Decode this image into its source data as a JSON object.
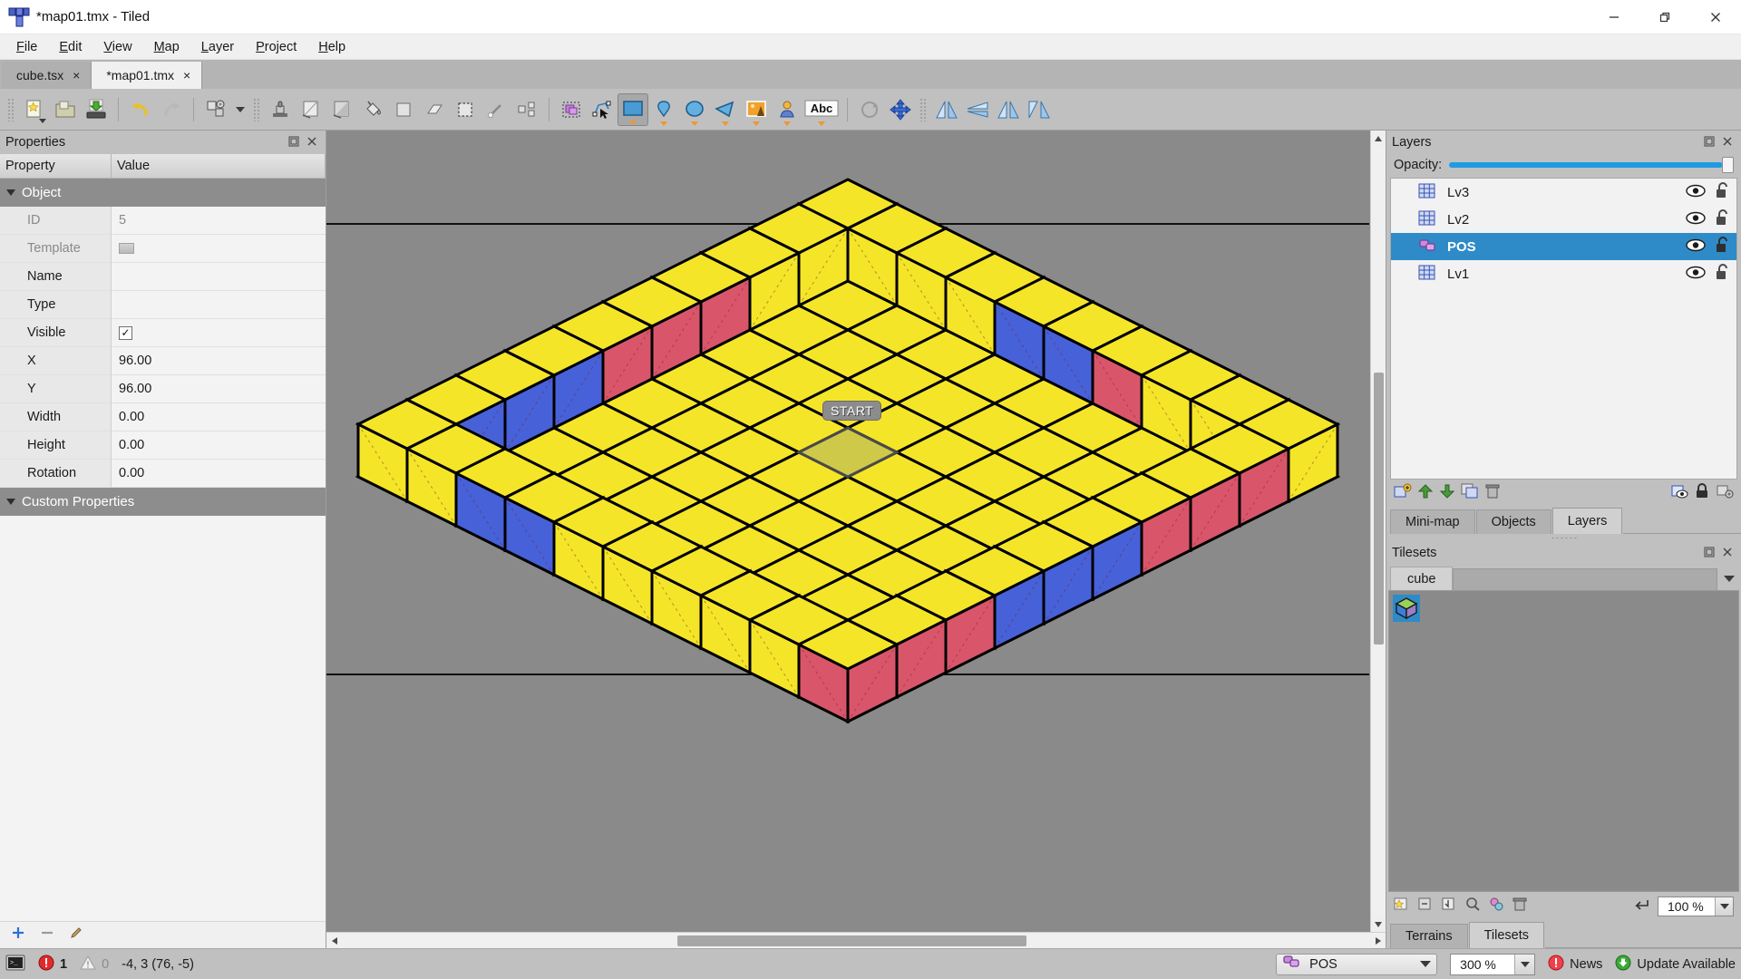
{
  "window": {
    "title": "*map01.tmx - Tiled",
    "app_icon": "tiled-logo-icon",
    "controls": {
      "minimize": "minimize-icon",
      "restore": "restore-icon",
      "close": "close-icon"
    }
  },
  "menu": {
    "items": [
      "File",
      "Edit",
      "View",
      "Map",
      "Layer",
      "Project",
      "Help"
    ]
  },
  "document_tabs": [
    {
      "label": "cube.tsx",
      "active": false,
      "close": "×"
    },
    {
      "label": "*map01.tmx",
      "active": true,
      "close": "×"
    }
  ],
  "toolbar": {
    "groups": [
      {
        "buttons": [
          {
            "name": "new-map-button",
            "icon": "new-file-icon",
            "dropdown": true
          },
          {
            "name": "open-file-button",
            "icon": "open-folder-icon"
          },
          {
            "name": "save-file-button",
            "icon": "save-disk-icon"
          }
        ]
      },
      {
        "buttons": [
          {
            "name": "undo-button",
            "icon": "undo-arrow-icon"
          },
          {
            "name": "redo-button",
            "icon": "redo-arrow-icon"
          }
        ]
      },
      {
        "buttons": [
          {
            "name": "map-properties-button",
            "icon": "map-properties-icon",
            "dropdown_separate": true
          }
        ]
      },
      {
        "buttons": [
          {
            "name": "stamp-brush-tool",
            "icon": "stamp-icon"
          },
          {
            "name": "terrain-brush-tool",
            "icon": "terrain-icon"
          },
          {
            "name": "shape-fill-tool",
            "icon": "shape-fill-icon"
          },
          {
            "name": "bucket-fill-tool",
            "icon": "bucket-fill-icon"
          },
          {
            "name": "eraser-tool",
            "icon": "eraser-square-icon"
          },
          {
            "name": "rectangle-erase-tool",
            "icon": "eraser-icon"
          },
          {
            "name": "rectangular-select-tool",
            "icon": "marquee-select-icon"
          },
          {
            "name": "magic-wand-tool",
            "icon": "magic-wand-icon"
          },
          {
            "name": "select-same-tile-tool",
            "icon": "select-same-tile-icon"
          }
        ]
      },
      {
        "buttons": [
          {
            "name": "select-objects-tool",
            "icon": "select-objects-icon"
          },
          {
            "name": "edit-polygons-tool",
            "icon": "edit-polygons-icon"
          },
          {
            "name": "insert-rectangle-tool",
            "icon": "insert-rectangle-icon",
            "active": true,
            "caret": true
          },
          {
            "name": "insert-point-tool",
            "icon": "insert-point-icon",
            "caret": true
          },
          {
            "name": "insert-ellipse-tool",
            "icon": "insert-ellipse-icon",
            "caret": true
          },
          {
            "name": "insert-polygon-tool",
            "icon": "insert-polygon-icon",
            "caret": true
          },
          {
            "name": "insert-tile-tool",
            "icon": "insert-tile-icon",
            "caret": true
          },
          {
            "name": "insert-template-tool",
            "icon": "insert-template-icon",
            "caret": true
          },
          {
            "name": "insert-text-tool",
            "icon": "insert-text-icon",
            "label": "Abc",
            "caret": true
          }
        ]
      },
      {
        "buttons": [
          {
            "name": "rotate-tool",
            "icon": "rotate-icon"
          },
          {
            "name": "move-tool",
            "icon": "move-arrows-icon"
          }
        ]
      },
      {
        "buttons": [
          {
            "name": "flip-horizontally-button",
            "icon": "flip-horizontal-icon"
          },
          {
            "name": "flip-vertically-button",
            "icon": "flip-vertical-icon"
          },
          {
            "name": "rotate-left-button",
            "icon": "rotate-left-icon"
          },
          {
            "name": "rotate-right-button",
            "icon": "rotate-right-icon"
          }
        ]
      }
    ]
  },
  "properties_panel": {
    "title": "Properties",
    "columns": [
      "Property",
      "Value"
    ],
    "group": {
      "label": "Object",
      "expanded": true
    },
    "rows": [
      {
        "key": "ID",
        "value": "5",
        "dim": true,
        "type": "text"
      },
      {
        "key": "Template",
        "value": "",
        "dim": true,
        "type": "template"
      },
      {
        "key": "Name",
        "value": "",
        "type": "text"
      },
      {
        "key": "Type",
        "value": "",
        "type": "text"
      },
      {
        "key": "Visible",
        "value": "✓",
        "type": "checkbox",
        "checked": true
      },
      {
        "key": "X",
        "value": "96.00",
        "type": "text"
      },
      {
        "key": "Y",
        "value": "96.00",
        "type": "text"
      },
      {
        "key": "Width",
        "value": "0.00",
        "type": "text"
      },
      {
        "key": "Height",
        "value": "0.00",
        "type": "text"
      },
      {
        "key": "Rotation",
        "value": "0.00",
        "type": "text"
      }
    ],
    "custom_group": {
      "label": "Custom Properties",
      "expanded": true
    },
    "footer_buttons": [
      {
        "name": "add-property-button",
        "icon": "plus-icon"
      },
      {
        "name": "remove-property-button",
        "icon": "minus-icon"
      },
      {
        "name": "edit-property-button",
        "icon": "pencil-icon"
      }
    ]
  },
  "map": {
    "start_label": "START",
    "colors": {
      "yellow": "#f5e528",
      "red": "#d9566a",
      "blue": "#4761d8",
      "outline": "#000000",
      "background": "#8a8a8a",
      "selection": "#cfc94a"
    },
    "grid": {
      "cols": 10,
      "rows": 10
    },
    "selected_tile": {
      "col": 4,
      "row": 4
    }
  },
  "layers_panel": {
    "title": "Layers",
    "opacity_label": "Opacity:",
    "opacity_value": 100,
    "layers": [
      {
        "name": "Lv3",
        "type": "tile-layer",
        "icon": "tile-layer-icon",
        "visible": true,
        "locked": false,
        "selected": false
      },
      {
        "name": "Lv2",
        "type": "tile-layer",
        "icon": "tile-layer-icon",
        "visible": true,
        "locked": false,
        "selected": false
      },
      {
        "name": "POS",
        "type": "object-layer",
        "icon": "object-layer-icon",
        "visible": true,
        "locked": false,
        "selected": true
      },
      {
        "name": "Lv1",
        "type": "tile-layer",
        "icon": "tile-layer-icon",
        "visible": true,
        "locked": false,
        "selected": false
      }
    ],
    "toolbar_buttons": [
      {
        "name": "new-layer-button",
        "icon": "new-layer-icon"
      },
      {
        "name": "raise-layer-button",
        "icon": "arrow-up-icon"
      },
      {
        "name": "lower-layer-button",
        "icon": "arrow-down-icon"
      },
      {
        "name": "duplicate-layer-button",
        "icon": "duplicate-layer-icon"
      },
      {
        "name": "delete-layer-button",
        "icon": "trash-icon"
      },
      {
        "name": "show-hide-others-button",
        "icon": "eye-layers-icon"
      },
      {
        "name": "lock-others-button",
        "icon": "lock-icon"
      },
      {
        "name": "layer-options-button",
        "icon": "settings-icon"
      }
    ],
    "dock_buttons": [
      {
        "name": "float-panel-button",
        "icon": "float-icon"
      },
      {
        "name": "close-panel-button",
        "icon": "close-x-icon"
      }
    ]
  },
  "view_tabs": [
    {
      "label": "Mini-map",
      "active": false
    },
    {
      "label": "Objects",
      "active": false
    },
    {
      "label": "Layers",
      "active": true
    }
  ],
  "tilesets_panel": {
    "title": "Tilesets",
    "tabs": [
      {
        "label": "cube",
        "active": true
      }
    ],
    "tiles": [
      {
        "name": "cube-tile",
        "selected": true
      }
    ],
    "toolbar_buttons": [
      {
        "name": "new-tileset-button",
        "icon": "new-tileset-icon"
      },
      {
        "name": "embed-tileset-button",
        "icon": "embed-icon"
      },
      {
        "name": "export-tileset-button",
        "icon": "export-icon"
      },
      {
        "name": "edit-tileset-button",
        "icon": "edit-tileset-icon"
      },
      {
        "name": "tileset-properties-button",
        "icon": "tileset-props-icon"
      },
      {
        "name": "remove-tileset-button",
        "icon": "trash-icon"
      }
    ],
    "wrap_button": {
      "name": "dynamic-wrap-button",
      "icon": "wrap-icon"
    },
    "zoom": "100 %",
    "dock_buttons": [
      {
        "name": "float-panel-button",
        "icon": "float-icon"
      },
      {
        "name": "close-panel-button",
        "icon": "close-x-icon"
      }
    ]
  },
  "bottom_tabs": [
    {
      "label": "Terrains",
      "active": false
    },
    {
      "label": "Tilesets",
      "active": true
    }
  ],
  "statusbar": {
    "console_button": {
      "name": "console-button",
      "icon": "console-icon"
    },
    "error_count": "1",
    "warning_count": "0",
    "coordinates": "-4, 3 (76, -5)",
    "current_layer": "POS",
    "current_layer_icon": "object-layer-icon",
    "zoom": "300 %",
    "news_label": "News",
    "update_label": "Update Available"
  }
}
